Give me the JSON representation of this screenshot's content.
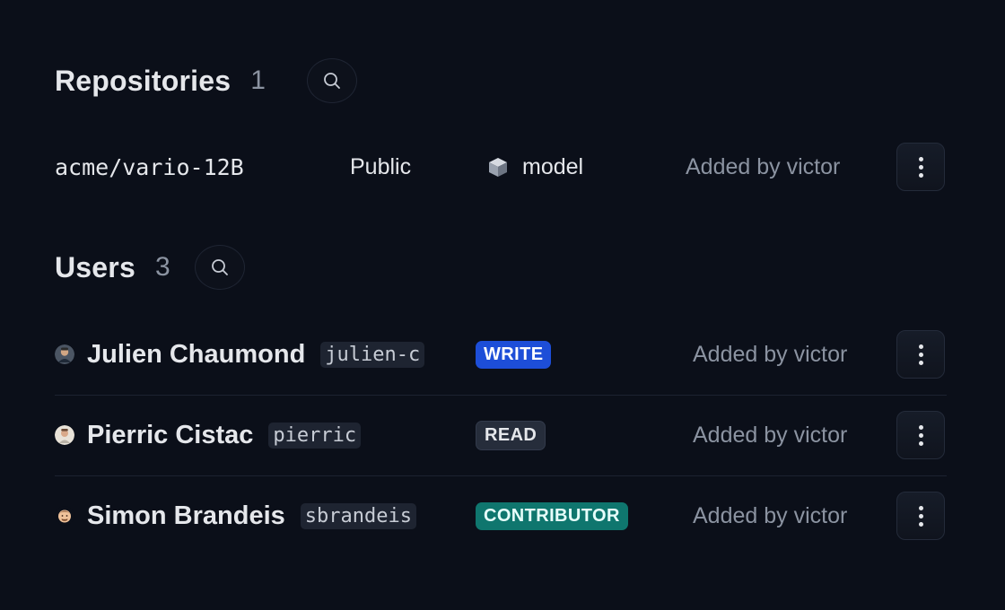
{
  "repositories": {
    "title": "Repositories",
    "count": "1",
    "search_icon": "search-icon",
    "items": [
      {
        "name": "acme/vario-12B",
        "visibility": "Public",
        "type_icon": "cube-icon",
        "type": "model",
        "added_by": "Added by victor",
        "menu_icon": "more-vertical-icon"
      }
    ]
  },
  "users": {
    "title": "Users",
    "count": "3",
    "search_icon": "search-icon",
    "items": [
      {
        "name": "Julien Chaumond",
        "handle": "julien-c",
        "role": "WRITE",
        "role_color": "#1d4ed8",
        "added_by": "Added by victor",
        "avatar_icon": "avatar-photo"
      },
      {
        "name": "Pierric Cistac",
        "handle": "pierric",
        "role": "READ",
        "role_color": "#262d3b",
        "added_by": "Added by victor",
        "avatar_icon": "avatar-photo"
      },
      {
        "name": "Simon Brandeis",
        "handle": "sbrandeis",
        "role": "CONTRIBUTOR",
        "role_color": "#0f766e",
        "added_by": "Added by victor",
        "avatar_icon": "avatar-emoji"
      }
    ]
  },
  "colors": {
    "background": "#0b0f19",
    "text": "#e5e7eb",
    "muted": "#8b93a1"
  }
}
